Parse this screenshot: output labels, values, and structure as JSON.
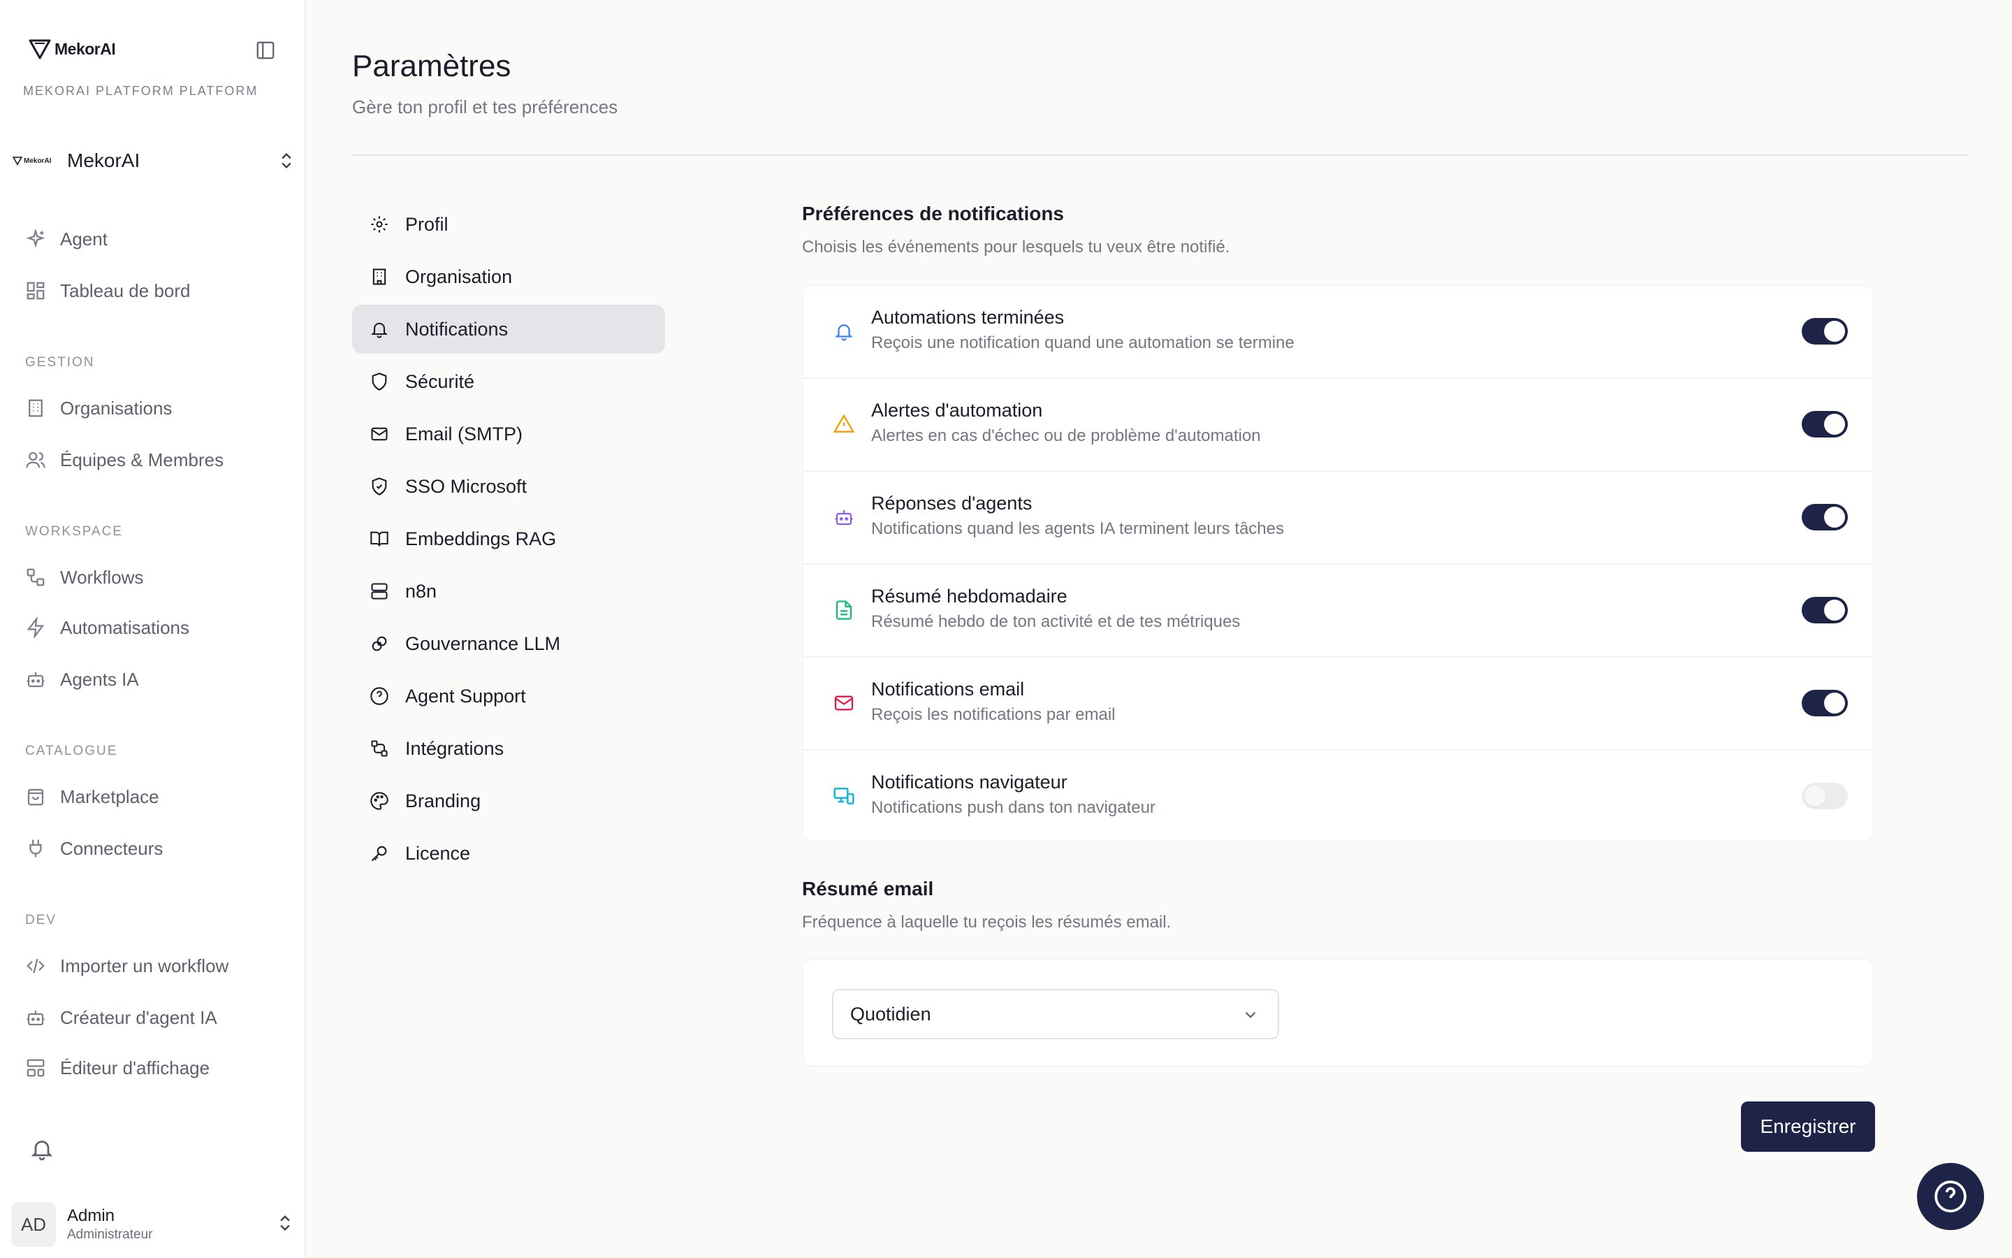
{
  "sidebar": {
    "brand": "MekorAI",
    "platform_label": "MEKORAI PLATFORM PLATFORM",
    "org_switcher": {
      "logo_text": "MekorAI",
      "name": "MekorAI"
    },
    "top_items": [
      {
        "label": "Agent",
        "icon": "sparkles-icon"
      },
      {
        "label": "Tableau de bord",
        "icon": "dashboard-icon"
      }
    ],
    "sections": [
      {
        "title": "GESTION",
        "items": [
          {
            "label": "Organisations",
            "icon": "building-icon"
          },
          {
            "label": "Équipes & Membres",
            "icon": "users-icon"
          }
        ]
      },
      {
        "title": "WORKSPACE",
        "items": [
          {
            "label": "Workflows",
            "icon": "workflow-icon"
          },
          {
            "label": "Automatisations",
            "icon": "zap-icon"
          },
          {
            "label": "Agents IA",
            "icon": "bot-icon"
          }
        ]
      },
      {
        "title": "CATALOGUE",
        "items": [
          {
            "label": "Marketplace",
            "icon": "shopping-bag-icon"
          },
          {
            "label": "Connecteurs",
            "icon": "plug-icon"
          }
        ]
      },
      {
        "title": "DEV",
        "items": [
          {
            "label": "Importer un workflow",
            "icon": "code-icon"
          },
          {
            "label": "Créateur d'agent IA",
            "icon": "bot-icon"
          },
          {
            "label": "Éditeur d'affichage",
            "icon": "layout-icon"
          }
        ]
      }
    ],
    "user": {
      "initials": "AD",
      "name": "Admin",
      "role": "Administrateur"
    }
  },
  "header": {
    "title": "Paramètres",
    "subtitle": "Gère ton profil et tes préférences"
  },
  "settings_nav": [
    {
      "label": "Profil",
      "icon": "gear-icon",
      "active": false
    },
    {
      "label": "Organisation",
      "icon": "building-icon",
      "active": false
    },
    {
      "label": "Notifications",
      "icon": "bell-icon",
      "active": true
    },
    {
      "label": "Sécurité",
      "icon": "shield-icon",
      "active": false
    },
    {
      "label": "Email (SMTP)",
      "icon": "mail-icon",
      "active": false
    },
    {
      "label": "SSO Microsoft",
      "icon": "shield-check-icon",
      "active": false
    },
    {
      "label": "Embeddings RAG",
      "icon": "book-icon",
      "active": false
    },
    {
      "label": "n8n",
      "icon": "server-icon",
      "active": false
    },
    {
      "label": "Gouvernance LLM",
      "icon": "brain-icon",
      "active": false
    },
    {
      "label": "Agent Support",
      "icon": "help-circle-icon",
      "active": false
    },
    {
      "label": "Intégrations",
      "icon": "integration-icon",
      "active": false
    },
    {
      "label": "Branding",
      "icon": "palette-icon",
      "active": false
    },
    {
      "label": "Licence",
      "icon": "key-icon",
      "active": false
    }
  ],
  "notifications": {
    "title": "Préférences de notifications",
    "description": "Choisis les événements pour lesquels tu veux être notifié.",
    "items": [
      {
        "title": "Automations terminées",
        "description": "Reçois une notification quand une automation se termine",
        "icon": "bell-icon",
        "icon_color": "#3b82f6",
        "enabled": true
      },
      {
        "title": "Alertes d'automation",
        "description": "Alertes en cas d'échec ou de problème d'automation",
        "icon": "warning-icon",
        "icon_color": "#f59e0b",
        "enabled": true
      },
      {
        "title": "Réponses d'agents",
        "description": "Notifications quand les agents IA terminent leurs tâches",
        "icon": "bot-icon",
        "icon_color": "#8b5cf6",
        "enabled": true
      },
      {
        "title": "Résumé hebdomadaire",
        "description": "Résumé hebdo de ton activité et de tes métriques",
        "icon": "file-text-icon",
        "icon_color": "#10b981",
        "enabled": true
      },
      {
        "title": "Notifications email",
        "description": "Reçois les notifications par email",
        "icon": "mail-icon",
        "icon_color": "#e11d48",
        "enabled": true
      },
      {
        "title": "Notifications navigateur",
        "description": "Notifications push dans ton navigateur",
        "icon": "monitor-icon",
        "icon_color": "#06b6d4",
        "enabled": false
      }
    ]
  },
  "email_summary": {
    "title": "Résumé email",
    "description": "Fréquence à laquelle tu reçois les résumés email.",
    "frequency": "Quotidien"
  },
  "actions": {
    "save_label": "Enregistrer"
  },
  "colors": {
    "primary": "#1e2448",
    "active_nav_bg": "#e4e5e8"
  }
}
